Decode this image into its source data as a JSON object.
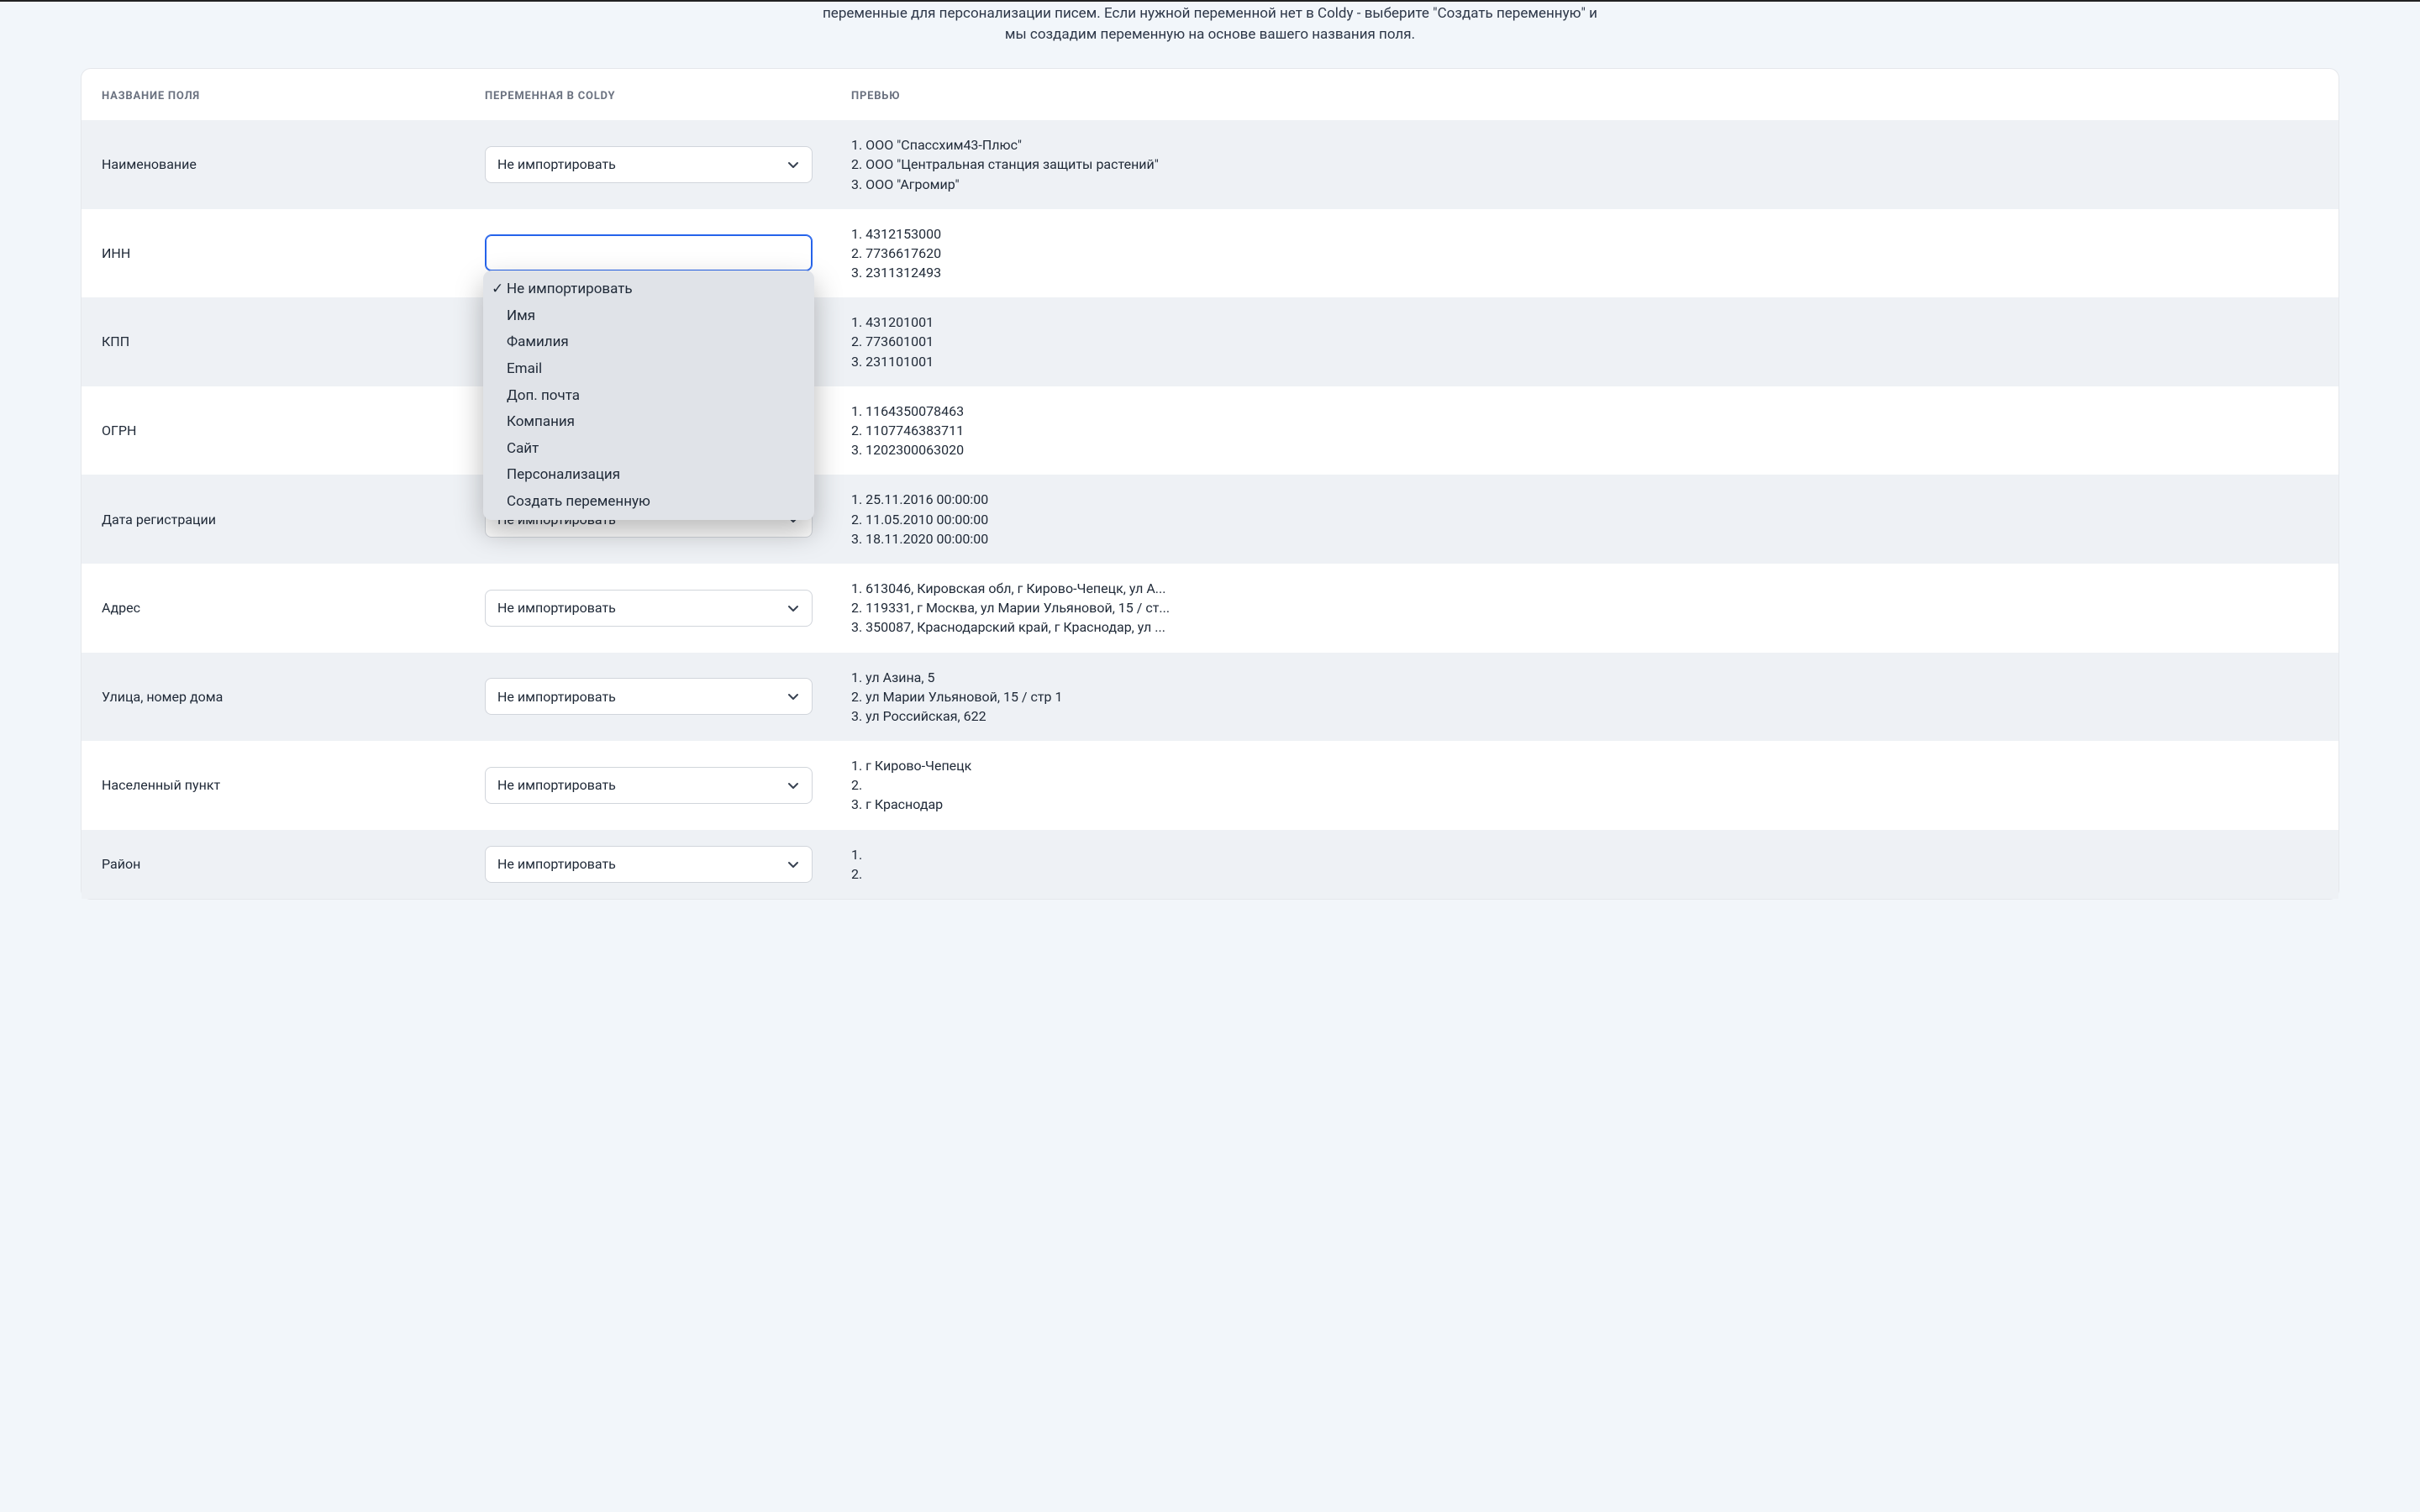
{
  "intro_line1": "переменные для персонализации писем. Если нужной переменной нет в Coldy - выберите \"Создать переменную\" и",
  "intro_line2": "мы создадим переменную на основе вашего названия поля.",
  "headers": {
    "field_name": "НАЗВАНИЕ ПОЛЯ",
    "variable": "ПЕРЕМЕННАЯ В COLDY",
    "preview": "ПРЕВЬЮ"
  },
  "default_select_label": "Не импортировать",
  "dropdown_options": [
    {
      "label": "Не импортировать",
      "selected": true
    },
    {
      "label": "Имя",
      "selected": false
    },
    {
      "label": "Фамилия",
      "selected": false
    },
    {
      "label": "Email",
      "selected": false
    },
    {
      "label": "Доп. почта",
      "selected": false
    },
    {
      "label": "Компания",
      "selected": false
    },
    {
      "label": "Сайт",
      "selected": false
    },
    {
      "label": "Персонализация",
      "selected": false
    },
    {
      "label": "Создать переменную",
      "selected": false
    }
  ],
  "rows": [
    {
      "name": "Наименование",
      "preview": [
        "1. ООО \"Спассхим43-Плюс\"",
        "2. ООО \"Центральная станция защиты растений\"",
        "3. ООО \"Агромир\""
      ],
      "alt": true,
      "open": false
    },
    {
      "name": "ИНН",
      "preview": [
        "1. 4312153000",
        "2. 7736617620",
        "3. 2311312493"
      ],
      "alt": false,
      "open": true
    },
    {
      "name": "КПП",
      "preview": [
        "1. 431201001",
        "2. 773601001",
        "3. 231101001"
      ],
      "alt": true,
      "open": false,
      "hide_select": true
    },
    {
      "name": "ОГРН",
      "preview": [
        "1. 1164350078463",
        "2. 1107746383711",
        "3. 1202300063020"
      ],
      "alt": false,
      "open": false,
      "hide_select": true
    },
    {
      "name": "Дата регистрации",
      "preview": [
        "1. 25.11.2016 00:00:00",
        "2. 11.05.2010 00:00:00",
        "3. 18.11.2020 00:00:00"
      ],
      "alt": true,
      "open": false
    },
    {
      "name": "Адрес",
      "preview": [
        "1. 613046, Кировская обл, г Кирово-Чепецк, ул А...",
        "2. 119331, г Москва, ул Марии Ульяновой, 15 / ст...",
        "3. 350087, Краснодарский край, г Краснодар, ул ..."
      ],
      "alt": false,
      "open": false
    },
    {
      "name": "Улица, номер дома",
      "preview": [
        "1. ул Азина, 5",
        "2. ул Марии Ульяновой, 15 / стр 1",
        "3. ул Российская, 622"
      ],
      "alt": true,
      "open": false
    },
    {
      "name": "Населенный пункт",
      "preview": [
        "1. г Кирово-Чепецк",
        "2.",
        "3. г Краснодар"
      ],
      "alt": false,
      "open": false
    },
    {
      "name": "Район",
      "preview": [
        "1.",
        "2."
      ],
      "alt": true,
      "open": false
    }
  ]
}
